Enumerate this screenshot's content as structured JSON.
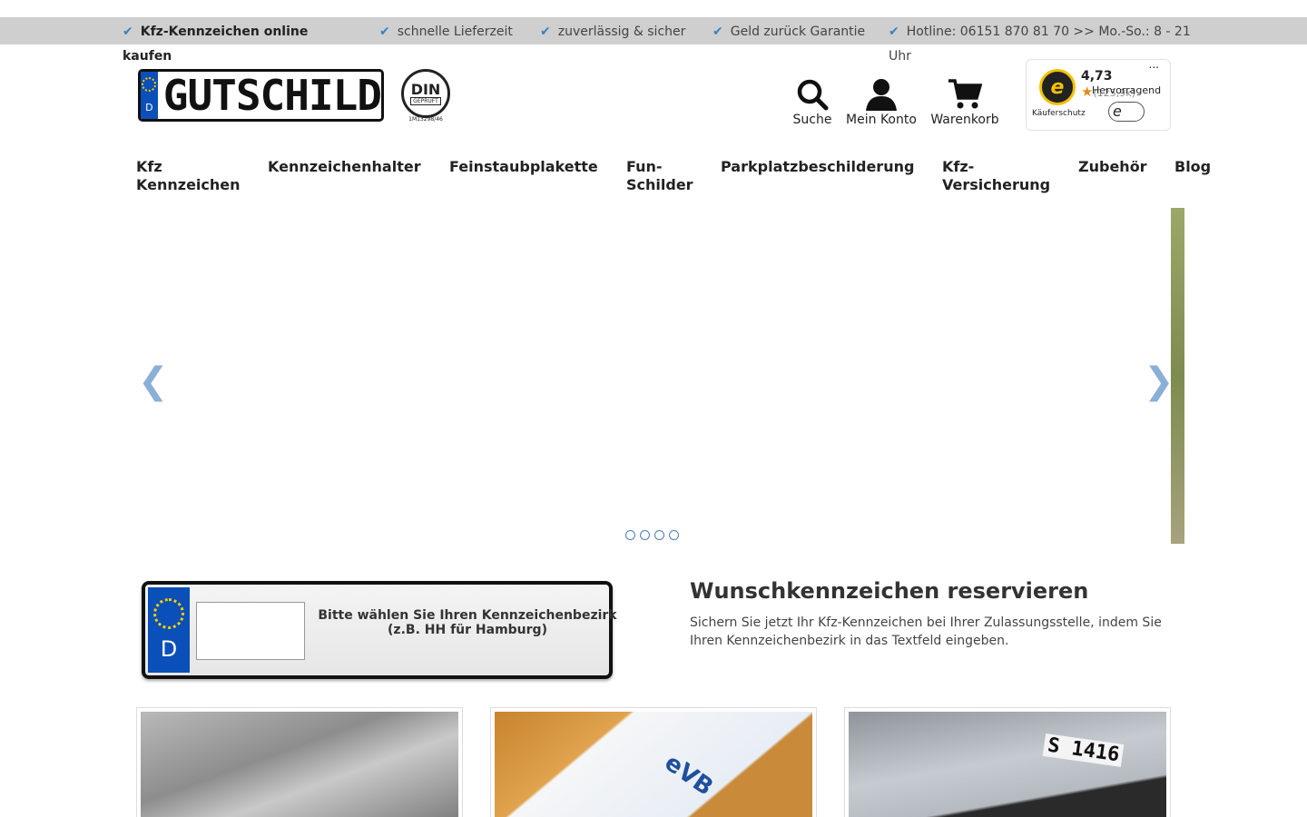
{
  "usp_bar": {
    "items": [
      {
        "text": "Kfz-Kennzeichen online kaufen",
        "bold": true
      },
      {
        "text": "schnelle Lieferzeit"
      },
      {
        "text": "zuverlässig & sicher"
      },
      {
        "text": "Geld zurück Garantie"
      },
      {
        "text": "Hotline: 06151 870 81 70 >> Mo.-So.: 8 - 21 Uhr"
      }
    ]
  },
  "header": {
    "logo_text": "GUTSCHILD",
    "logo_country": "D",
    "din_label": "DIN",
    "din_sub": "GEPRÜFT",
    "din_code": "1M13298/46",
    "links": {
      "search": "Suche",
      "account": "Mein Konto",
      "cart": "Warenkorb"
    },
    "trust": {
      "score": "4,73",
      "count": "(125,9k)",
      "rating_label": "Hervorragend",
      "protection": "Käuferschutz",
      "menu": "..."
    }
  },
  "nav": {
    "items": [
      "Kfz Kennzeichen",
      "Kennzeichenhalter",
      "Feinstaubplakette",
      "Fun-Schilder",
      "Parkplatzbeschilderung",
      "Kfz-Versicherung",
      "Zubehör",
      "Blog"
    ]
  },
  "slider": {
    "prev": "❮",
    "next": "❯",
    "dot_count": 4
  },
  "reservation": {
    "plate_country": "D",
    "input_value": "",
    "hint": "Bitte wählen Sie Ihren Kennzeichenbezirk (z.B. HH für Hamburg)",
    "title": "Wunschkennzeichen reservieren",
    "text": "Sichern Sie jetzt Ihr Kfz-Kennzeichen bei Ihrer Zulassungsstelle, indem Sie Ihren Kennzeichenbezirk in das Textfeld eingeben."
  },
  "cards": {
    "card2_overlay": "eVB",
    "card3_overlay": "S 1416"
  },
  "colors": {
    "accent": "#3b7fc4",
    "eu_blue": "#0b4fb8",
    "usp_bg": "#cfcfcf"
  }
}
